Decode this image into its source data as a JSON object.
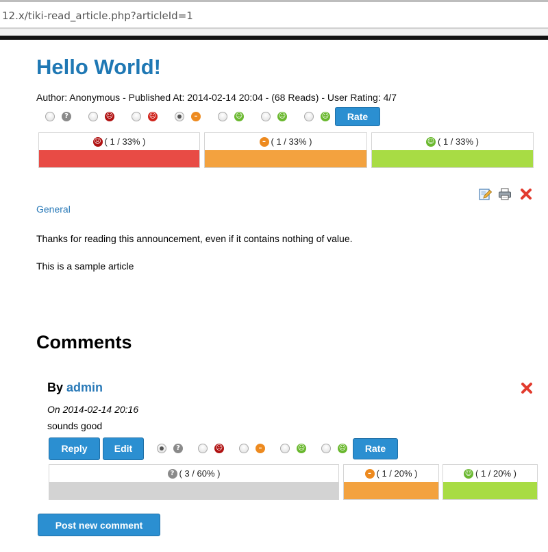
{
  "browser": {
    "url": "12.x/tiki-read_article.php?articleId=1"
  },
  "article": {
    "title": "Hello World!",
    "meta": "Author: Anonymous - Published At: 2014-02-14 20:04 - (68 Reads) - User Rating: 4/7",
    "rate_label": "Rate",
    "rating_options": [
      {
        "icon": "gray-question-face-icon",
        "selected": false
      },
      {
        "icon": "red-sad-face-icon",
        "selected": false
      },
      {
        "icon": "red-angry-face-icon",
        "selected": false
      },
      {
        "icon": "orange-neutral-face-icon",
        "selected": true
      },
      {
        "icon": "green-smile-face-icon",
        "selected": false
      },
      {
        "icon": "green-happy-face-icon",
        "selected": false
      },
      {
        "icon": "green-grin-face-icon",
        "selected": false
      }
    ],
    "results": [
      {
        "label": "( 1 / 33% )",
        "icon": "red-sad-face-icon",
        "color": "#e84b45"
      },
      {
        "label": "( 1 / 33% )",
        "icon": "orange-neutral-face-icon",
        "color": "#f3a23f"
      },
      {
        "label": "( 1 / 33% )",
        "icon": "green-smile-face-icon",
        "color": "#a8dc44"
      }
    ],
    "category": "General",
    "lead": "Thanks for reading this announcement, even if it contains nothing of value.",
    "body": "This is a sample article"
  },
  "comments": {
    "heading": "Comments",
    "items": [
      {
        "by_prefix": "By",
        "author": "admin",
        "date": "On 2014-02-14 20:16",
        "text": "sounds good",
        "reply_label": "Reply",
        "edit_label": "Edit",
        "rate_label": "Rate",
        "rating_options": [
          {
            "icon": "gray-question-face-icon",
            "selected": true
          },
          {
            "icon": "red-sad-face-icon",
            "selected": false
          },
          {
            "icon": "orange-neutral-face-icon",
            "selected": false
          },
          {
            "icon": "green-smile-face-icon",
            "selected": false
          },
          {
            "icon": "green-grin-face-icon",
            "selected": false
          }
        ],
        "results": [
          {
            "label": "( 3 / 60% )",
            "icon": "gray-question-face-icon",
            "color": "#d3d3d3"
          },
          {
            "label": "( 1 / 20% )",
            "icon": "orange-neutral-face-icon",
            "color": "#f3a23f"
          },
          {
            "label": "( 1 / 20% )",
            "icon": "green-smile-face-icon",
            "color": "#a8dc44"
          }
        ]
      }
    ],
    "post_label": "Post new comment"
  },
  "colors": {
    "link": "#2a7ab8",
    "title": "#1f78b4",
    "button": "#2b8fd1",
    "delete": "#e23b2e"
  }
}
